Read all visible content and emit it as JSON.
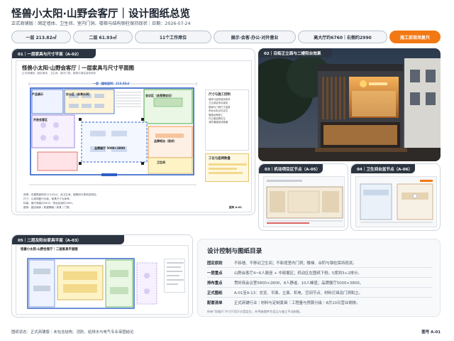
{
  "header": {
    "title": "怪兽小太阳·山野会客厅｜设计图纸总览",
    "subtitle": "正式商铺版｜固定墙体、卫生间、室内门洞、楼梯与结构钢柱保持现状｜日期：2026-07-24"
  },
  "pills": [
    {
      "label": "一层 213.82㎡"
    },
    {
      "label": "二层 61.93㎡"
    },
    {
      "label": "11个工作席位"
    },
    {
      "label": "展示·会客·办公·对外营业"
    },
    {
      "label": "高大厅约6760｜右侧约2990"
    },
    {
      "label": "施工前现场复尺"
    }
  ],
  "panel1": {
    "tag": "01｜一层家具与尺寸平面（A-02）",
    "sheet_title": "怪兽小太阳·山野会客厅｜一层家具与尺寸平面图",
    "sheet_sub": "正式商铺版｜固定墙体、卫生间、室内门洞、楼梯与钢柱保持现状",
    "area_label": "一层（建筑面积）213.82㎡",
    "rooms": {
      "product": "产品展示",
      "office": "办公区（含茶水间）",
      "meeting": "会议区（含视频会议）",
      "lounge": "开放会客区",
      "toilet": "卫生间",
      "bar": "品牌吧台（现状）",
      "workarea": "品牌展厅 5000×3800"
    },
    "side_title": "尺寸与施工控制",
    "side_items": [
      "墙体与结构保持现状",
      "卫生间给排水接驳",
      "楼梯与门洞尺寸复核",
      "吧台水电点位定位",
      "展墙龙骨施工",
      "外立面招牌定位",
      "消防通道保持畅通"
    ],
    "side_title2": "工位与座椅数量",
    "notes": [
      "说明：总建筑面积约213.82㎡，含卫生间、楼梯间与现状结构柱。",
      "尺寸：以现场复尺为准，家具尺寸为参考。",
      "标高：室内净高约3000，吧台区域约2990。",
      "图例：固定墙体 / 新建隔墙 / 家具 / 门洞。"
    ],
    "sheet_no": "图号 A-02"
  },
  "panel2": {
    "tag": "02｜沿街正立面与二楼阳台效果"
  },
  "panel3": {
    "tag": "03｜机动项目区节点（A-05）"
  },
  "panel4": {
    "tag": "04｜卫生间台盆节点（A-06）"
  },
  "panel5": {
    "tag": "05｜二层及阳台家具平面（A-03）",
    "sheet_title": "怪兽小太阳·山野会客厅｜二层家具平面图"
  },
  "toc": {
    "title": "设计控制与图纸目录",
    "rows": [
      {
        "key": "固定原则",
        "value": "不拆墙、不移动卫生间；不新增室内门洞；楼梯、台阶与钢柱保持现状。"
      },
      {
        "key": "一层重点",
        "value": "山野会客厅4~6人散座 + 中部展区；机动区在图纸下侧，5席到3+2排分。"
      },
      {
        "key": "排布重点",
        "value": "贯岭商会议室5800×2800，8人静谧、10人峰值；品牌展厅5000×3800。"
      },
      {
        "key": "正式图纸",
        "value": "A-01至A-13：总览、平面、立面、机电、空间节点、材料灯具及门洞和立。"
      },
      {
        "key": "配套清单",
        "value": "正式商铺行业｜材料与定制家具｜工程量与预算分级｜8月10日营业倒排。"
      }
    ],
    "note": "所有“坝道尺”尺寸只用于方案定位，外壳施图件为设立与施工手动刻图。"
  },
  "footer": {
    "left": "图纸状态：正式商铺版｜未包含结构、消防、给排水与电气专业审图结论",
    "right": "图号 A-01"
  },
  "colors": {
    "accent": "#f27813",
    "dark": "#2b3440",
    "plan_blue": "#2f5fc7"
  }
}
